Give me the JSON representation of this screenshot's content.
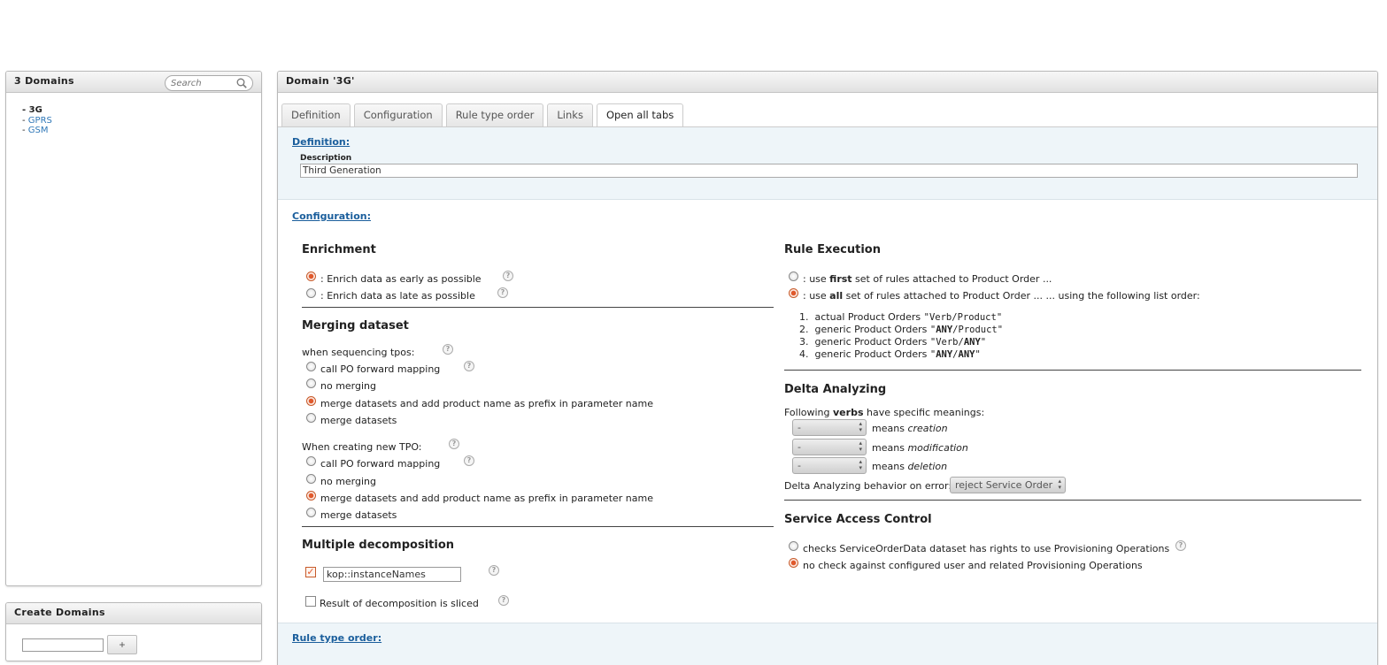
{
  "left_panel": {
    "title": "3 Domains",
    "search_placeholder": "Search",
    "domains": [
      {
        "label": "3G"
      },
      {
        "label": "GPRS"
      },
      {
        "label": "GSM"
      }
    ],
    "bullet": "- "
  },
  "create_panel": {
    "title": "Create Domains",
    "add_label": "+"
  },
  "main": {
    "title": "Domain '3G'",
    "tabs": [
      "Definition",
      "Configuration",
      "Rule type order",
      "Links",
      "Open all tabs"
    ],
    "active_tab": "Open all tabs",
    "definition": {
      "link": "Definition:",
      "description_label": "Description",
      "description_value": "Third Generation"
    },
    "configuration": {
      "link": "Configuration:",
      "enrichment": {
        "title": "Enrichment",
        "options": [
          ": Enrich data as early as possible",
          ": Enrich data as late as possible"
        ],
        "selected": 0
      },
      "merging": {
        "title": "Merging dataset",
        "seq_label": "when sequencing tpos:",
        "seq_options": [
          "call PO forward mapping",
          "no merging",
          "merge datasets and add product name as prefix in parameter name",
          "merge datasets"
        ],
        "seq_selected": 2,
        "new_label": "When creating new TPO:",
        "new_options": [
          "call PO forward mapping",
          "no merging",
          "merge datasets and add product name as prefix in parameter name",
          "merge datasets"
        ],
        "new_selected": 2
      },
      "decomposition": {
        "title": "Multiple decomposition",
        "checked": true,
        "field_value": "kop::instanceNames",
        "sliced_label": "Result of decomposition is sliced",
        "sliced_checked": false
      },
      "rule_execution": {
        "title": "Rule Execution",
        "opt1_pre": ": use ",
        "opt1_bold": "first",
        "opt1_post": " set of rules attached to Product Order ...",
        "opt2_pre": ": use ",
        "opt2_bold": "all",
        "opt2_post": " set of rules attached to Product Order ... ... using the following list order:",
        "selected": 1,
        "order": [
          {
            "num": "1.",
            "text": "actual Product Orders ",
            "q1": "\"",
            "a": "Verb",
            "sep": "/",
            "b": "Product",
            "q2": "\"",
            "bold_a": false,
            "bold_b": false
          },
          {
            "num": "2.",
            "text": "generic Product Orders ",
            "q1": "\"",
            "a": "ANY",
            "sep": "/",
            "b": "Product",
            "q2": "\"",
            "bold_a": true,
            "bold_b": false
          },
          {
            "num": "3.",
            "text": "generic Product Orders ",
            "q1": "\"",
            "a": "Verb",
            "sep": "/",
            "b": "ANY",
            "q2": "\"",
            "bold_a": false,
            "bold_b": true
          },
          {
            "num": "4.",
            "text": "generic Product Orders ",
            "q1": "\"",
            "a": "ANY",
            "sep": "/",
            "b": "ANY",
            "q2": "\"",
            "bold_a": true,
            "bold_b": true
          }
        ]
      },
      "delta": {
        "title": "Delta Analyzing",
        "intro_pre": "Following ",
        "intro_bold": "verbs",
        "intro_post": " have specific meanings:",
        "rows": [
          {
            "select": "-",
            "means": "means ",
            "what": "creation"
          },
          {
            "select": "-",
            "means": "means ",
            "what": "modification"
          },
          {
            "select": "-",
            "means": "means ",
            "what": "deletion"
          }
        ],
        "error_label": "Delta Analyzing behavior on error:",
        "error_value": "reject Service Order"
      },
      "sac": {
        "title": "Service Access Control",
        "options": [
          "checks ServiceOrderData dataset has rights to use Provisioning Operations",
          "no check against configured user and related Provisioning Operations"
        ],
        "selected": 1
      }
    },
    "rule_type_order": {
      "link": "Rule type order:"
    },
    "help_glyph": "?"
  },
  "colors": {
    "accent": "#e0592c",
    "link": "#1a5e9c",
    "section_bg": "#eef5f9"
  }
}
